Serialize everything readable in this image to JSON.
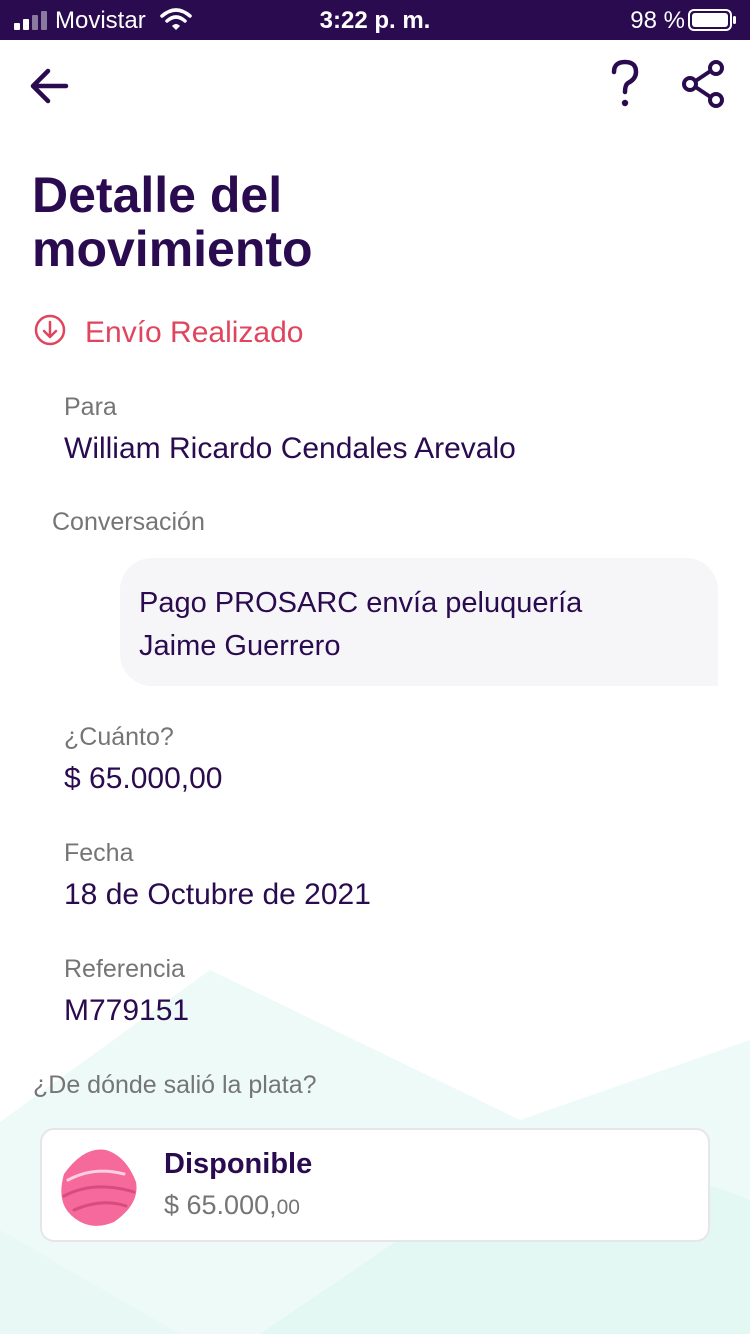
{
  "status_bar": {
    "carrier": "Movistar",
    "time": "3:22 p. m.",
    "battery": "98 %",
    "signal_icon": "signal-icon",
    "wifi_icon": "wifi-icon",
    "battery_icon": "battery-icon"
  },
  "toolbar": {
    "back_icon": "arrow-left-icon",
    "help_label": "?",
    "share_icon": "share-icon"
  },
  "page": {
    "title_line1": "Detalle del",
    "title_line2": "movimiento"
  },
  "movement": {
    "status_icon": "arrow-down-circle-icon",
    "status": "Envío Realizado",
    "to_label": "Para",
    "to_value": "William Ricardo Cendales Arevalo",
    "conversation_label": "Conversación",
    "message_line1": "Pago PROSARC envía peluquería",
    "message_line2": "Jaime Guerrero",
    "amount_label": "¿Cuánto?",
    "amount_value": "$ 65.000,00",
    "date_label": "Fecha",
    "date_value": "18 de Octubre de 2021",
    "reference_label": "Referencia",
    "reference_value": "M779151"
  },
  "source": {
    "label": "¿De dónde salió la plata?",
    "account_icon": "pocket-icon",
    "account_name": "Disponible",
    "account_amount_main": "$ 65.000,",
    "account_amount_cents": "00"
  },
  "colors": {
    "primary": "#2a0b4f",
    "status_red": "#e0455e",
    "label_gray": "#757575",
    "bubble_bg": "#f6f5f8",
    "accent_pink": "#f56a9a"
  }
}
